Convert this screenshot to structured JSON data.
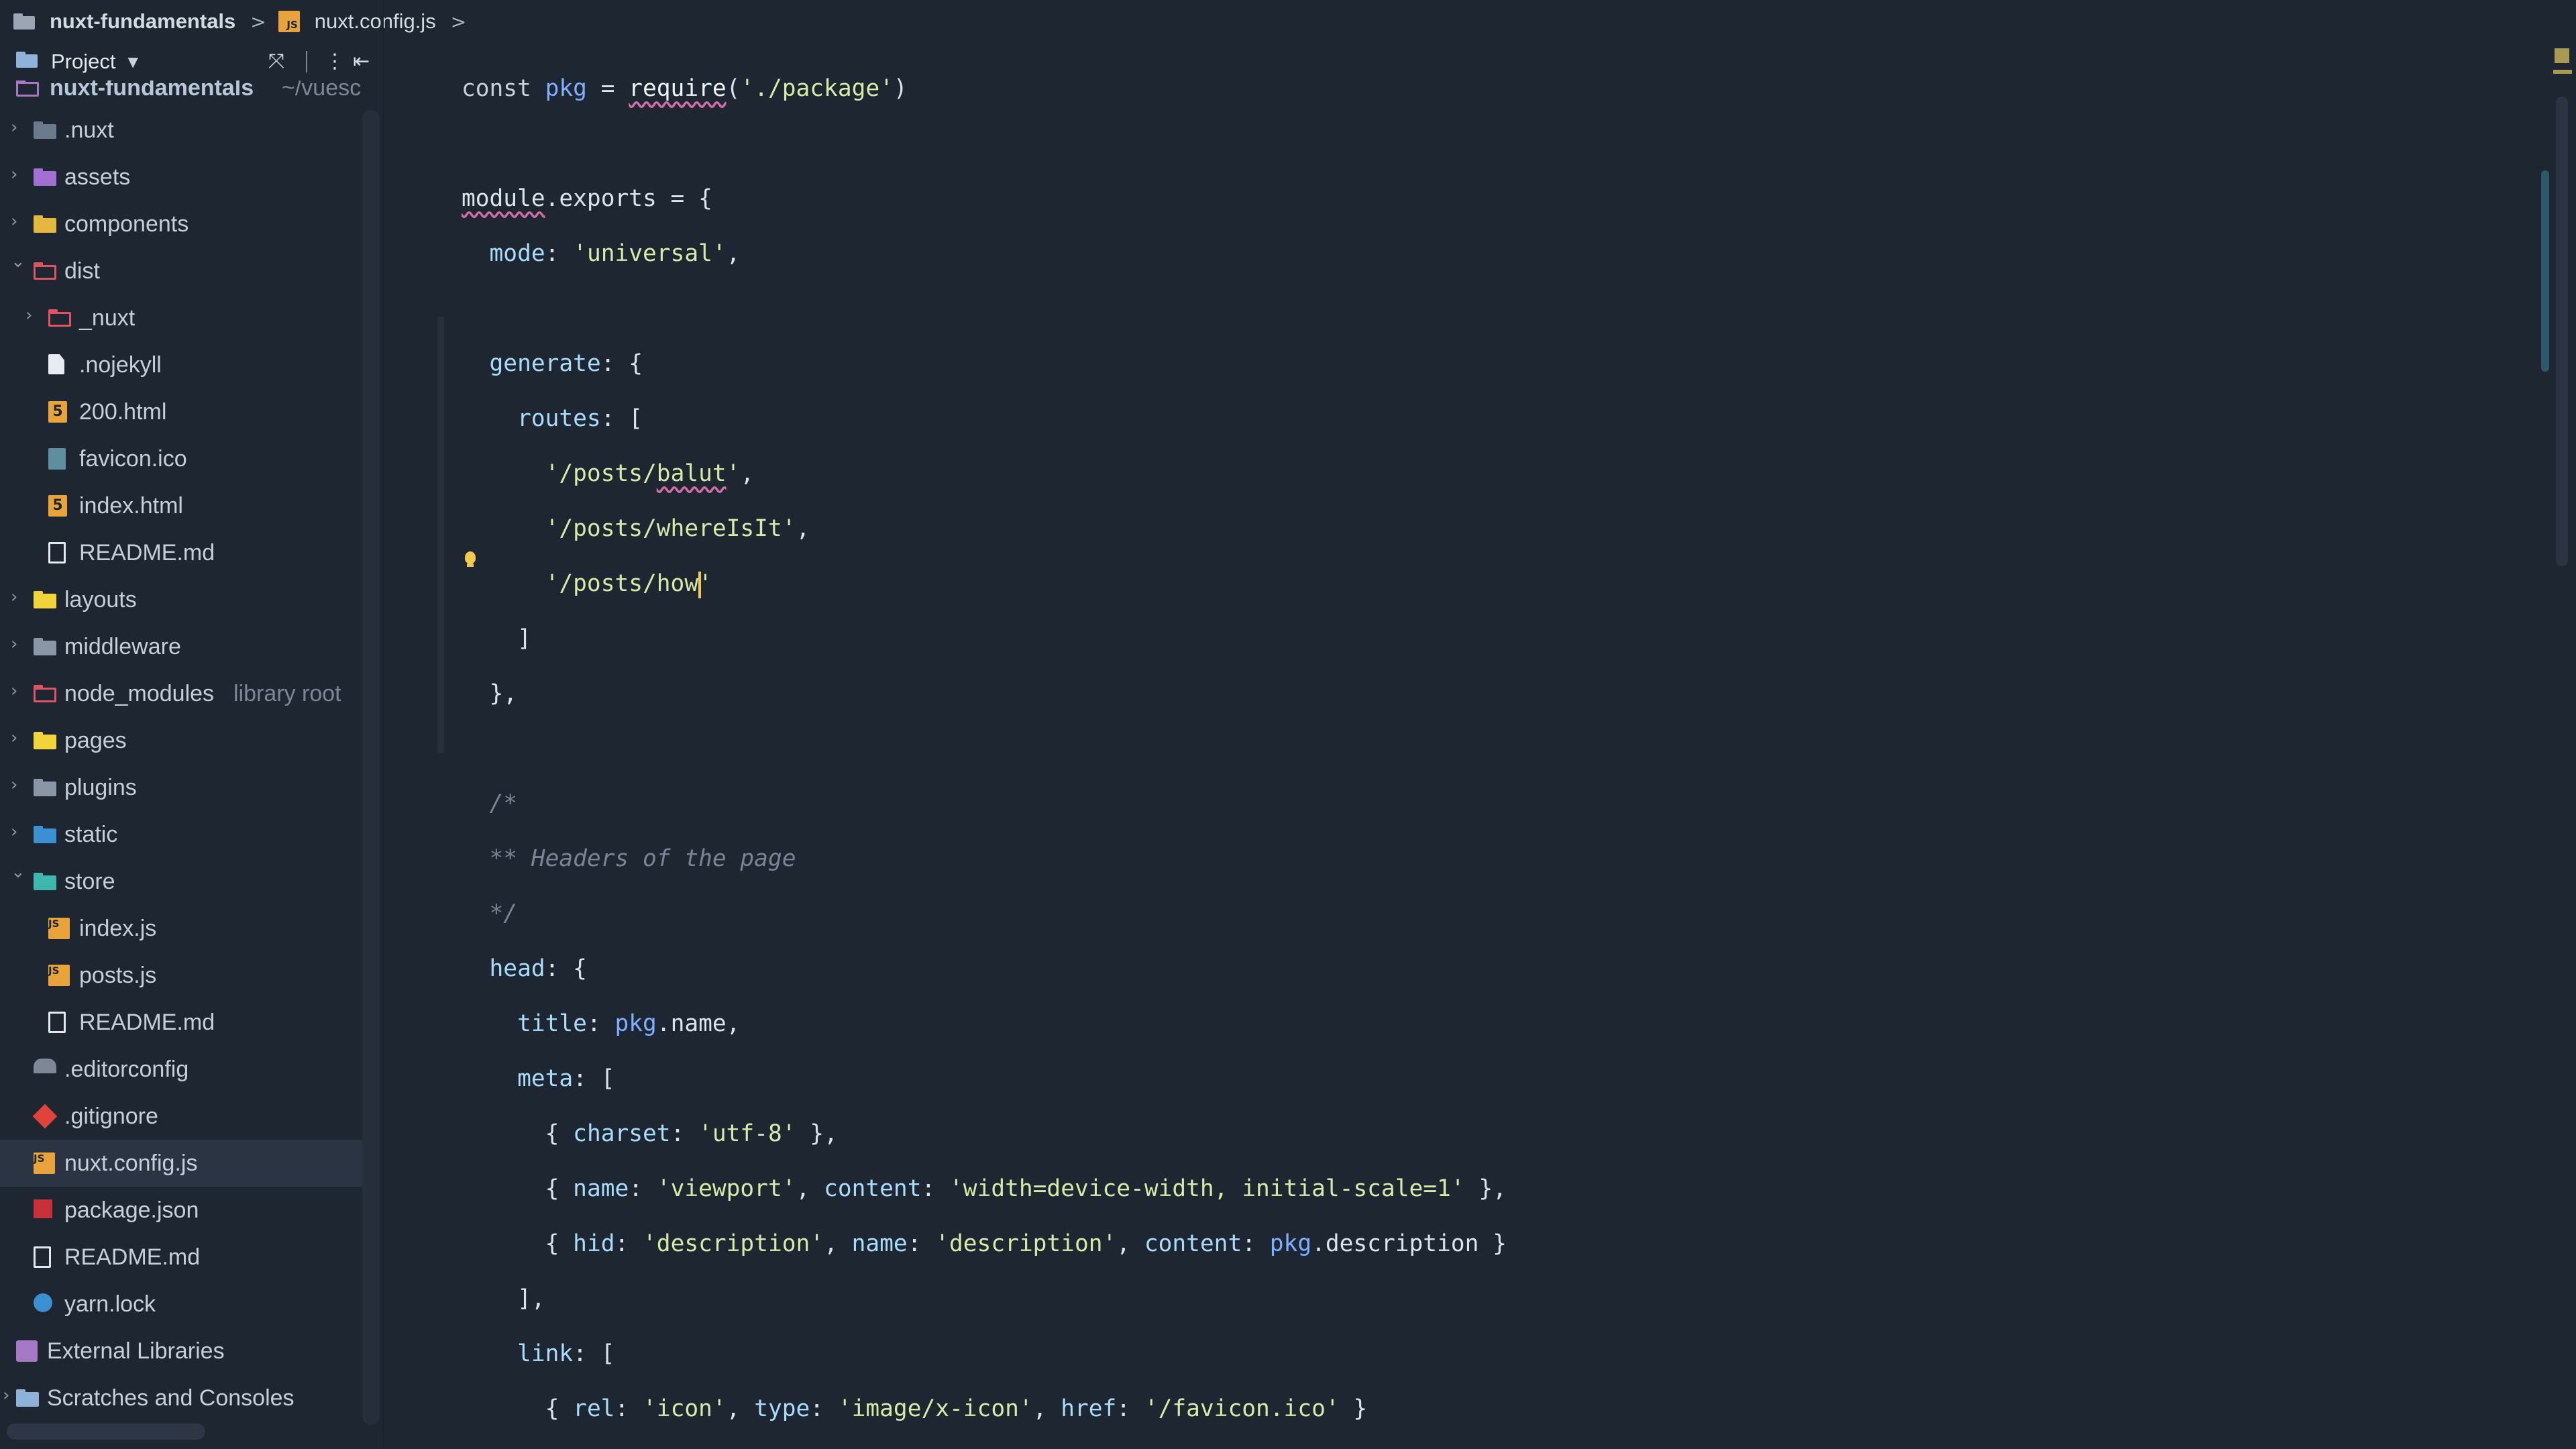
{
  "navbar": {
    "project": "nuxt-fundamentals",
    "file": "nuxt.config.js",
    "separator": ">"
  },
  "project_panel": {
    "title": "Project",
    "root_label": "nuxt-fundamentals",
    "root_path": "~/vuesc",
    "items": [
      {
        "label": ".nuxt",
        "icon": "folder-icon",
        "color": "#6b7a8c"
      },
      {
        "label": "assets",
        "icon": "folder-icon",
        "color": "#a36fd2"
      },
      {
        "label": "components",
        "icon": "folder-icon",
        "color": "#e6b73d"
      },
      {
        "label": "dist",
        "icon": "folder-outline-icon",
        "color": "#e05462"
      },
      {
        "label": "_nuxt",
        "icon": "folder-outline-icon",
        "color": "#e05462"
      },
      {
        "label": ".nojekyll",
        "icon": "file-icon"
      },
      {
        "label": "200.html",
        "icon": "html-icon"
      },
      {
        "label": "favicon.ico",
        "icon": "image-icon"
      },
      {
        "label": "index.html",
        "icon": "html-icon"
      },
      {
        "label": "README.md",
        "icon": "markdown-icon"
      },
      {
        "label": "layouts",
        "icon": "folder-icon",
        "color": "#f0d43a"
      },
      {
        "label": "middleware",
        "icon": "folder-icon",
        "color": "#8a95a5"
      },
      {
        "label": "node_modules",
        "hint": "library root",
        "icon": "folder-outline-icon",
        "color": "#e05462"
      },
      {
        "label": "pages",
        "icon": "folder-icon",
        "color": "#f0d43a"
      },
      {
        "label": "plugins",
        "icon": "folder-icon",
        "color": "#8a95a5"
      },
      {
        "label": "static",
        "icon": "folder-icon",
        "color": "#3c8fd0"
      },
      {
        "label": "store",
        "icon": "folder-icon",
        "color": "#3fb6b0"
      },
      {
        "label": "index.js",
        "icon": "js-icon"
      },
      {
        "label": "posts.js",
        "icon": "js-icon"
      },
      {
        "label": "README.md",
        "icon": "markdown-icon"
      },
      {
        "label": ".editorconfig",
        "icon": "config-icon"
      },
      {
        "label": ".gitignore",
        "icon": "git-icon"
      },
      {
        "label": "nuxt.config.js",
        "icon": "js-icon",
        "selected": true
      },
      {
        "label": "package.json",
        "icon": "npm-icon"
      },
      {
        "label": "README.md",
        "icon": "markdown-icon"
      },
      {
        "label": "yarn.lock",
        "icon": "yarn-icon"
      },
      {
        "label": "External Libraries",
        "icon": "library-icon"
      },
      {
        "label": "Scratches and Consoles",
        "icon": "scratches-icon"
      }
    ]
  },
  "editor": {
    "language": "javascript",
    "lines": [
      [
        [
          "const ",
          "kw"
        ],
        [
          "pkg",
          "var"
        ],
        [
          " = ",
          "plain"
        ],
        [
          "require",
          "fn"
        ],
        [
          "(",
          "plain"
        ],
        [
          "'./package'",
          "str"
        ],
        [
          ")",
          "plain"
        ]
      ],
      [],
      [
        [
          "module",
          "warn"
        ],
        [
          ".exports = {",
          "plain"
        ]
      ],
      [
        [
          "  mode",
          "prop"
        ],
        [
          ": ",
          "plain"
        ],
        [
          "'universal'",
          "str"
        ],
        [
          ",",
          "plain"
        ]
      ],
      [],
      [
        [
          "  generate",
          "prop"
        ],
        [
          ": {",
          "plain"
        ]
      ],
      [
        [
          "    routes",
          "prop"
        ],
        [
          ": [",
          "plain"
        ]
      ],
      [
        [
          "      '/posts/",
          "str"
        ],
        [
          "balut",
          "warn-str"
        ],
        [
          "'",
          "str"
        ],
        [
          ",",
          "plain"
        ]
      ],
      [
        [
          "      '/posts/whereIsIt'",
          "str"
        ],
        [
          ",",
          "plain"
        ]
      ],
      [
        [
          "      '/posts/how",
          "str"
        ],
        [
          "",
          "caret"
        ],
        [
          "'",
          "str"
        ]
      ],
      [
        [
          "    ]",
          "plain"
        ]
      ],
      [
        [
          "  },",
          "plain"
        ]
      ],
      [],
      [
        [
          "  /*",
          "comment"
        ]
      ],
      [
        [
          "  ** Headers of the page",
          "comment"
        ]
      ],
      [
        [
          "  */",
          "comment"
        ]
      ],
      [
        [
          "  head",
          "prop"
        ],
        [
          ": {",
          "plain"
        ]
      ],
      [
        [
          "    title",
          "prop"
        ],
        [
          ": ",
          "plain"
        ],
        [
          "pkg",
          "var"
        ],
        [
          ".name,",
          "plain"
        ]
      ],
      [
        [
          "    meta",
          "prop"
        ],
        [
          ": [",
          "plain"
        ]
      ],
      [
        [
          "      { ",
          "plain"
        ],
        [
          "charset",
          "prop"
        ],
        [
          ": ",
          "plain"
        ],
        [
          "'utf-8'",
          "str"
        ],
        [
          " },",
          "plain"
        ]
      ],
      [
        [
          "      { ",
          "plain"
        ],
        [
          "name",
          "prop"
        ],
        [
          ": ",
          "plain"
        ],
        [
          "'viewport'",
          "str"
        ],
        [
          ", ",
          "plain"
        ],
        [
          "content",
          "prop"
        ],
        [
          ": ",
          "plain"
        ],
        [
          "'width=device-width, initial-scale=1'",
          "str"
        ],
        [
          " },",
          "plain"
        ]
      ],
      [
        [
          "      { ",
          "plain"
        ],
        [
          "hid",
          "prop"
        ],
        [
          ": ",
          "plain"
        ],
        [
          "'description'",
          "str"
        ],
        [
          ", ",
          "plain"
        ],
        [
          "name",
          "prop"
        ],
        [
          ": ",
          "plain"
        ],
        [
          "'description'",
          "str"
        ],
        [
          ", ",
          "plain"
        ],
        [
          "content",
          "prop"
        ],
        [
          ": ",
          "plain"
        ],
        [
          "pkg",
          "var"
        ],
        [
          ".description }",
          "plain"
        ]
      ],
      [
        [
          "    ],",
          "plain"
        ]
      ],
      [
        [
          "    link",
          "prop"
        ],
        [
          ": [",
          "plain"
        ]
      ],
      [
        [
          "      { ",
          "plain"
        ],
        [
          "rel",
          "prop"
        ],
        [
          ": ",
          "plain"
        ],
        [
          "'icon'",
          "str"
        ],
        [
          ", ",
          "plain"
        ],
        [
          "type",
          "prop"
        ],
        [
          ": ",
          "plain"
        ],
        [
          "'image/x-icon'",
          "str"
        ],
        [
          ", ",
          "plain"
        ],
        [
          "href",
          "prop"
        ],
        [
          ": ",
          "plain"
        ],
        [
          "'/favicon.ico'",
          "str"
        ],
        [
          " }",
          "plain"
        ]
      ],
      [
        [
          "    ],",
          "plain"
        ]
      ]
    ]
  }
}
